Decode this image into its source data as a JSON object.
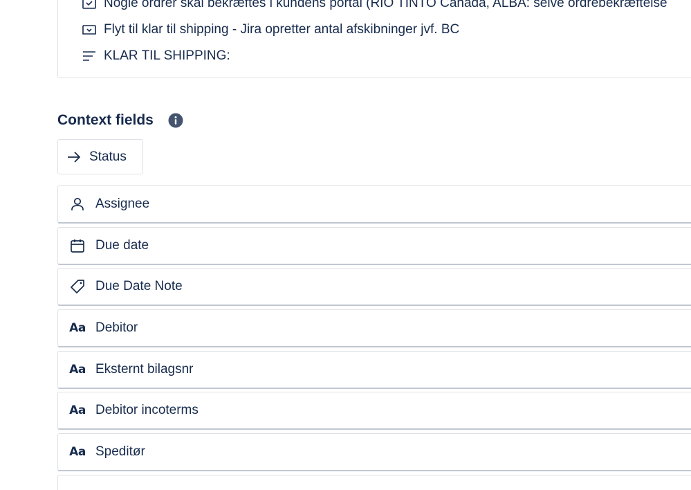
{
  "list": {
    "items": [
      {
        "icon": "checklist-icon",
        "text": "Nogle ordrer skal bekræftes i kundens portal (RIO TINTO Canada, ALBA: selve ordrebekræftelse"
      },
      {
        "icon": "checklist-icon",
        "text": "Flyt til klar til shipping - Jira opretter antal afskibninger jvf. BC"
      },
      {
        "icon": "text-lines-icon",
        "text": "KLAR TIL SHIPPING:"
      }
    ]
  },
  "context": {
    "title": "Context fields",
    "info_icon": "info-icon",
    "status_button": {
      "icon": "arrow-right-icon",
      "label": "Status"
    },
    "fields": [
      {
        "icon": "person-icon",
        "label": "Assignee"
      },
      {
        "icon": "calendar-icon",
        "label": "Due date"
      },
      {
        "icon": "tag-icon",
        "label": "Due Date Note"
      },
      {
        "icon": "text-field-icon",
        "icon_text": "Aa",
        "label": "Debitor"
      },
      {
        "icon": "text-field-icon",
        "icon_text": "Aa",
        "label": "Eksternt bilagsnr"
      },
      {
        "icon": "text-field-icon",
        "icon_text": "Aa",
        "label": "Debitor incoterms"
      },
      {
        "icon": "text-field-icon",
        "icon_text": "Aa",
        "label": "Speditør"
      }
    ]
  },
  "colors": {
    "text": "#172b4d",
    "border": "#dfe1e6",
    "border_strong": "#c1c7d0",
    "info_icon": "#44546f"
  }
}
